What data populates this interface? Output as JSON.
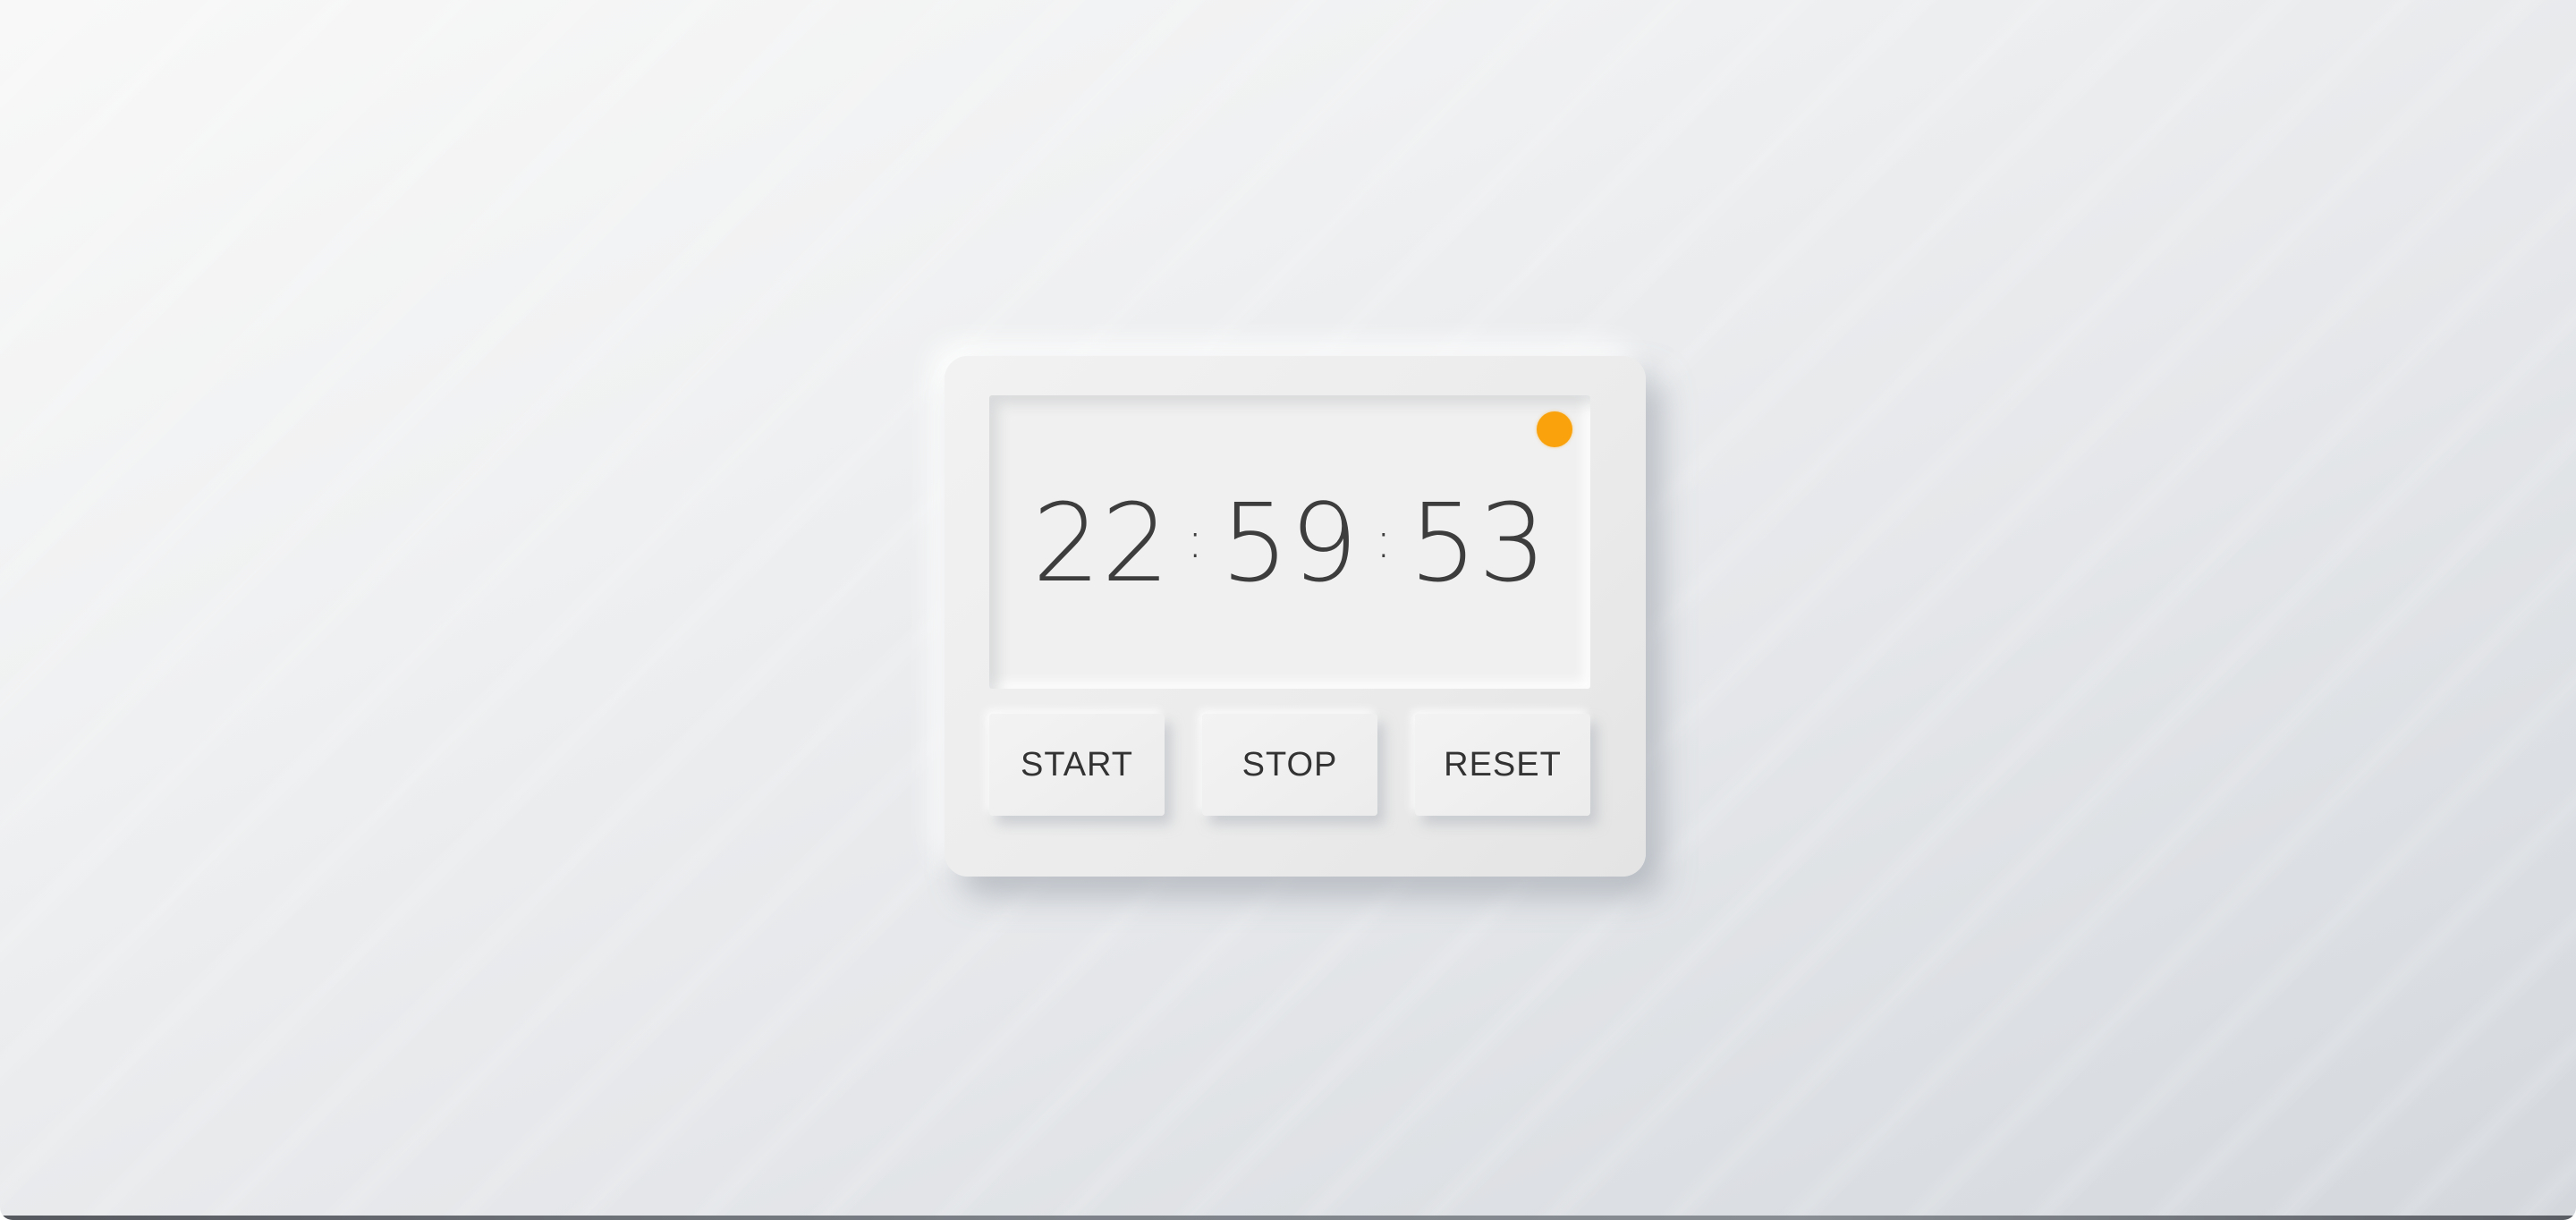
{
  "timer": {
    "hours": "22",
    "minutes": "59",
    "seconds": "53",
    "separator": ":",
    "indicator_color": "#f9a20c"
  },
  "controls": {
    "start_label": "START",
    "stop_label": "STOP",
    "reset_label": "RESET"
  }
}
